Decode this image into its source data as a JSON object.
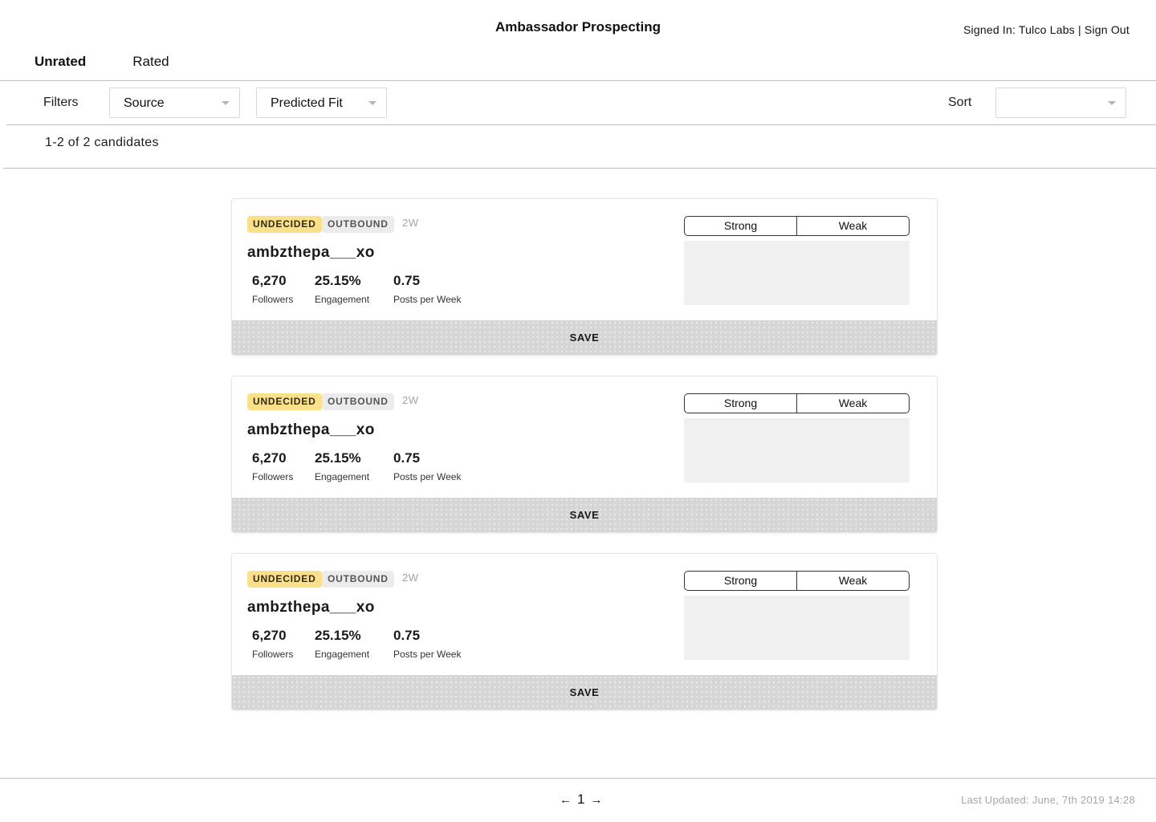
{
  "header": {
    "title": "Ambassador Prospecting",
    "signed_in_prefix": "Signed In:",
    "org_name": "Tulco Labs",
    "separator": "|",
    "sign_out": "Sign Out"
  },
  "tabs": [
    {
      "label": "Unrated",
      "active": true
    },
    {
      "label": "Rated",
      "active": false
    }
  ],
  "filters": {
    "label": "Filters",
    "source": {
      "value": "Source"
    },
    "predicted_fit": {
      "value": "Predicted Fit"
    },
    "sort_label": "Sort",
    "sort": {
      "value": ""
    }
  },
  "results": {
    "count_text": "1-2 of 2 candidates"
  },
  "cards": [
    {
      "status": "UNDECIDED",
      "source": "OUTBOUND",
      "age": "2W",
      "handle": "ambzthepa___xo",
      "followers": "6,270",
      "followers_label": "Followers",
      "engagement": "25.15%",
      "engagement_label": "Engagement",
      "posts": "0.75",
      "posts_label": "Posts per Week",
      "rating": {
        "strong": "Strong",
        "weak": "Weak"
      },
      "save": "SAVE"
    },
    {
      "status": "UNDECIDED",
      "source": "OUTBOUND",
      "age": "2W",
      "handle": "ambzthepa___xo",
      "followers": "6,270",
      "followers_label": "Followers",
      "engagement": "25.15%",
      "engagement_label": "Engagement",
      "posts": "0.75",
      "posts_label": "Posts per Week",
      "rating": {
        "strong": "Strong",
        "weak": "Weak"
      },
      "save": "SAVE"
    },
    {
      "status": "UNDECIDED",
      "source": "OUTBOUND",
      "age": "2W",
      "handle": "ambzthepa___xo",
      "followers": "6,270",
      "followers_label": "Followers",
      "engagement": "25.15%",
      "engagement_label": "Engagement",
      "posts": "0.75",
      "posts_label": "Posts per Week",
      "rating": {
        "strong": "Strong",
        "weak": "Weak"
      },
      "save": "SAVE"
    }
  ],
  "pagination": {
    "prev_icon": "arrow-left-icon",
    "page": "1",
    "next_icon": "arrow-right-icon"
  },
  "footer": {
    "last_updated": "Last Updated: June, 7th 2019 14:28"
  },
  "colors": {
    "status_badge": "#fbe08a",
    "source_badge": "#ececec",
    "save_bar": "#d6d6d6"
  }
}
